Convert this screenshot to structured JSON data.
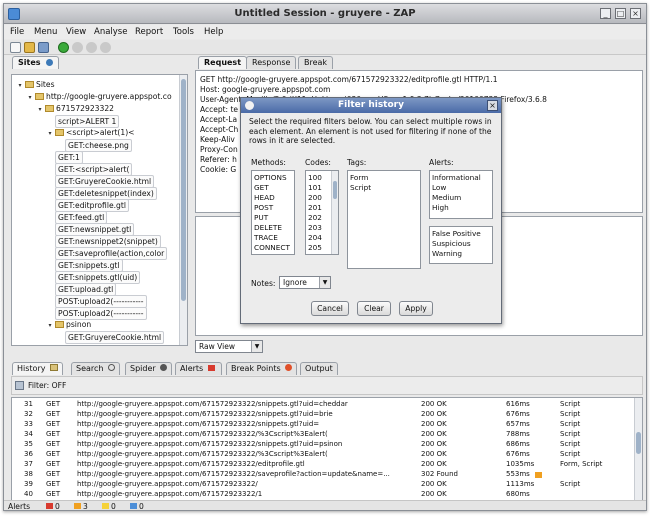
{
  "window": {
    "title": "Untitled Session - gruyere - ZAP"
  },
  "menu": [
    "File",
    "Menu",
    "View",
    "Analyse",
    "Report",
    "Tools",
    "Help"
  ],
  "sites_tab": {
    "label": "Sites"
  },
  "tree": [
    {
      "label": "Sites",
      "depth": 0,
      "toggle": "▾",
      "kind": "root"
    },
    {
      "label": "http://google-gruyere.appspot.co",
      "depth": 1,
      "toggle": "▾",
      "kind": "folder"
    },
    {
      "label": "671572923322",
      "depth": 2,
      "toggle": "▾",
      "kind": "folder"
    },
    {
      "label": "script>ALERT 1",
      "depth": 3,
      "toggle": "",
      "kind": "leaf"
    },
    {
      "label": "<script>alert(1)<",
      "depth": 3,
      "toggle": "▾",
      "kind": "folder"
    },
    {
      "label": "GET:cheese.png",
      "depth": 4,
      "toggle": "",
      "kind": "leaf"
    },
    {
      "label": "GET:1",
      "depth": 3,
      "toggle": "",
      "kind": "leaf"
    },
    {
      "label": "GET:<script>alert(",
      "depth": 3,
      "toggle": "",
      "kind": "leaf"
    },
    {
      "label": "GET:GruyereCookie.html",
      "depth": 3,
      "toggle": "",
      "kind": "leaf"
    },
    {
      "label": "GET:deletesnippet(index)",
      "depth": 3,
      "toggle": "",
      "kind": "leaf"
    },
    {
      "label": "GET:editprofile.gtl",
      "depth": 3,
      "toggle": "",
      "kind": "leaf"
    },
    {
      "label": "GET:feed.gtl",
      "depth": 3,
      "toggle": "",
      "kind": "leaf"
    },
    {
      "label": "GET:newsnippet.gtl",
      "depth": 3,
      "toggle": "",
      "kind": "leaf"
    },
    {
      "label": "GET:newsnippet2(snippet)",
      "depth": 3,
      "toggle": "",
      "kind": "leaf"
    },
    {
      "label": "GET:saveprofile(action,color",
      "depth": 3,
      "toggle": "",
      "kind": "leaf"
    },
    {
      "label": "GET:snippets.gtl",
      "depth": 3,
      "toggle": "",
      "kind": "leaf"
    },
    {
      "label": "GET:snippets.gtl(uid)",
      "depth": 3,
      "toggle": "",
      "kind": "leaf"
    },
    {
      "label": "GET:upload.gtl",
      "depth": 3,
      "toggle": "",
      "kind": "leaf"
    },
    {
      "label": "POST:upload2(-----------",
      "depth": 3,
      "toggle": "",
      "kind": "leaf"
    },
    {
      "label": "POST:upload2(-----------",
      "depth": 3,
      "toggle": "",
      "kind": "leaf"
    },
    {
      "label": "psinon",
      "depth": 3,
      "toggle": "▾",
      "kind": "folder"
    },
    {
      "label": "GET:GruyereCookie.html",
      "depth": 4,
      "toggle": "",
      "kind": "leaf"
    }
  ],
  "req_tabs": [
    "Request",
    "Response",
    "Break"
  ],
  "request_lines": [
    "GET http://google-gruyere.appspot.com/671572923322/editprofile.gtl HTTP/1.1",
    "Host: google-gruyere.appspot.com",
    "User-Agent: Mozilla/5.0 (X11; U; Linux i686; en-US; rv:1.9.2.7) Gecko/20100722 Firefox/3.6.8",
    "Accept: te",
    "Accept-La",
    "Accept-Ch",
    "Keep-Aliv",
    "Proxy-Con",
    "Referer: h",
    "Cookie: G"
  ],
  "raw_view": "Raw View",
  "dialog": {
    "title": "Filter history",
    "text": "Select the required filters below. You can select multiple rows in each element. An element is not used for filtering if none of the rows in it are selected.",
    "methods_label": "Methods:",
    "codes_label": "Codes:",
    "tags_label": "Tags:",
    "alerts_label": "Alerts:",
    "methods": [
      "OPTIONS",
      "GET",
      "HEAD",
      "POST",
      "PUT",
      "DELETE",
      "TRACE",
      "CONNECT"
    ],
    "codes": [
      "100",
      "101",
      "200",
      "201",
      "202",
      "203",
      "204",
      "205"
    ],
    "tags": [
      "Form",
      "Script"
    ],
    "alerts_risk": [
      "Informational",
      "Low",
      "Medium",
      "High"
    ],
    "alerts_reliability": [
      "False Positive",
      "Suspicious",
      "Warning"
    ],
    "notes_label": "Notes:",
    "notes_value": "Ignore",
    "cancel": "Cancel",
    "clear": "Clear",
    "apply": "Apply"
  },
  "bottom_tabs": [
    "History",
    "Search",
    "Spider",
    "Alerts",
    "Break Points",
    "Output"
  ],
  "filter_text": "Filter: OFF",
  "history_rows": [
    {
      "id": "31",
      "method": "GET",
      "url": "http://google-gruyere.appspot.com/671572923322/snippets.gtl?uid=cheddar",
      "code": "200 OK",
      "time": "616ms",
      "tags": "Script"
    },
    {
      "id": "32",
      "method": "GET",
      "url": "http://google-gruyere.appspot.com/671572923322/snippets.gtl?uid=brie",
      "code": "200 OK",
      "time": "676ms",
      "tags": "Script"
    },
    {
      "id": "33",
      "method": "GET",
      "url": "http://google-gruyere.appspot.com/671572923322/snippets.gtl?uid=",
      "code": "200 OK",
      "time": "657ms",
      "tags": "Script"
    },
    {
      "id": "34",
      "method": "GET",
      "url": "http://google-gruyere.appspot.com/671572923322/%3Cscript%3Ealert(",
      "code": "200 OK",
      "time": "788ms",
      "tags": "Script"
    },
    {
      "id": "35",
      "method": "GET",
      "url": "http://google-gruyere.appspot.com/671572923322/snippets.gtl?uid=psinon",
      "code": "200 OK",
      "time": "686ms",
      "tags": "Script"
    },
    {
      "id": "36",
      "method": "GET",
      "url": "http://google-gruyere.appspot.com/671572923322/%3Cscript%3Ealert(",
      "code": "200 OK",
      "time": "676ms",
      "tags": "Script"
    },
    {
      "id": "37",
      "method": "GET",
      "url": "http://google-gruyere.appspot.com/671572923322/editprofile.gtl",
      "code": "200 OK",
      "time": "1035ms",
      "tags": "Form, Script"
    },
    {
      "id": "38",
      "method": "GET",
      "url": "http://google-gruyere.appspot.com/671572923322/saveprofile?action=update&name=...",
      "code": "302 Found",
      "time": "553ms",
      "tags": ""
    },
    {
      "id": "39",
      "method": "GET",
      "url": "http://google-gruyere.appspot.com/671572923322/",
      "code": "200 OK",
      "time": "1113ms",
      "tags": "Script"
    },
    {
      "id": "40",
      "method": "GET",
      "url": "http://google-gruyere.appspot.com/671572923322/1",
      "code": "200 OK",
      "time": "680ms",
      "tags": ""
    }
  ],
  "status": {
    "label": "Alerts",
    "counts": [
      "0",
      "3",
      "0",
      "0"
    ]
  },
  "colors": {
    "flag_high": "#d83a2e",
    "flag_medium": "#f0a020",
    "flag_low": "#f5d23a",
    "flag_info": "#4d8fd8"
  }
}
